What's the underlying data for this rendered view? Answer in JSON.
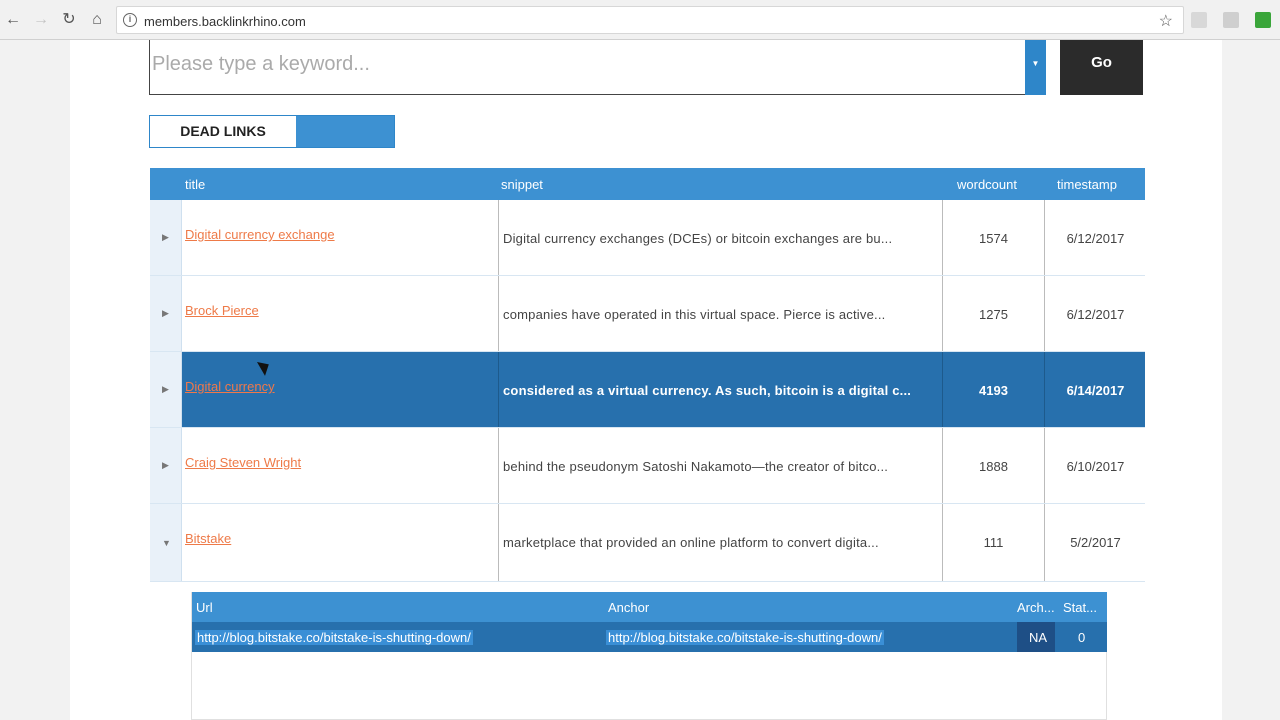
{
  "browser": {
    "url": "members.backlinkrhino.com"
  },
  "search": {
    "placeholder": "Please type a keyword...",
    "go_label": "Go"
  },
  "tabs": {
    "active_label": "DEAD LINKS"
  },
  "grid": {
    "headers": {
      "title": "title",
      "snippet": "snippet",
      "wordcount": "wordcount",
      "timestamp": "timestamp"
    },
    "rows": [
      {
        "title": "Digital currency exchange",
        "snippet": "Digital currency exchanges (DCEs) or bitcoin exchanges are bu...",
        "wordcount": "1574",
        "timestamp": "6/12/2017",
        "expanded": false,
        "selected": false
      },
      {
        "title": "Brock Pierce",
        "snippet": "companies have operated in this virtual space. Pierce is active...",
        "wordcount": "1275",
        "timestamp": "6/12/2017",
        "expanded": false,
        "selected": false
      },
      {
        "title": "Digital currency",
        "snippet": "considered as a virtual currency. As such, bitcoin is a digital c...",
        "wordcount": "4193",
        "timestamp": "6/14/2017",
        "expanded": false,
        "selected": true
      },
      {
        "title": "Craig Steven Wright",
        "snippet": "behind the pseudonym Satoshi Nakamoto—the creator of bitco...",
        "wordcount": "1888",
        "timestamp": "6/10/2017",
        "expanded": false,
        "selected": false
      },
      {
        "title": "Bitstake",
        "snippet": "marketplace that provided an online platform to convert digita...",
        "wordcount": "111",
        "timestamp": "5/2/2017",
        "expanded": true,
        "selected": false
      }
    ]
  },
  "subgrid": {
    "headers": {
      "url": "Url",
      "anchor": "Anchor",
      "archive": "Arch...",
      "status": "Stat..."
    },
    "rows": [
      {
        "url": "http://blog.bitstake.co/bitstake-is-shutting-down/",
        "anchor": "http://blog.bitstake.co/bitstake-is-shutting-down/",
        "archive": "NA",
        "status": "0"
      }
    ]
  }
}
